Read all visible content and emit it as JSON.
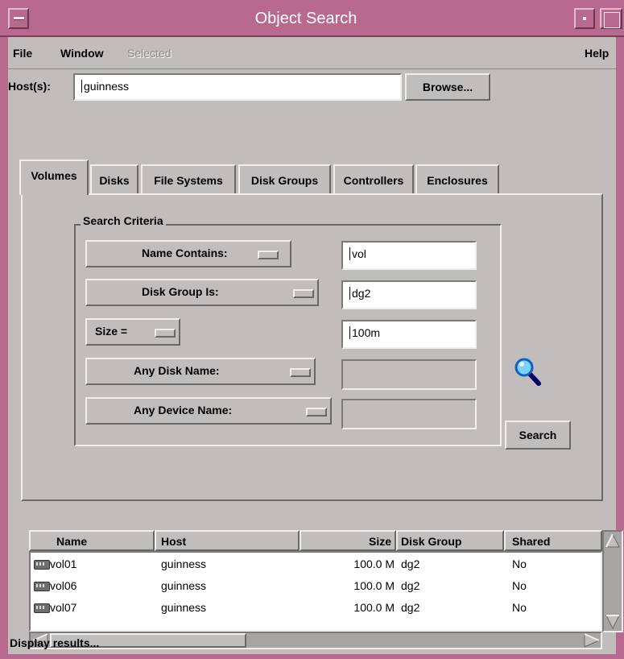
{
  "window": {
    "title": "Object Search"
  },
  "menu": {
    "file": "File",
    "window": "Window",
    "selected": "Selected",
    "help": "Help"
  },
  "host": {
    "label": "Host(s):",
    "value": "guinness",
    "browse_label": "Browse..."
  },
  "tabs": [
    "Volumes",
    "Disks",
    "File Systems",
    "Disk Groups",
    "Controllers",
    "Enclosures"
  ],
  "criteria": {
    "title": "Search Criteria",
    "rows": [
      {
        "option": "Name Contains:",
        "value": "vol"
      },
      {
        "option": "Disk Group Is:",
        "value": "dg2"
      },
      {
        "option": "Size =",
        "value": "100m"
      },
      {
        "option": "Any Disk Name:",
        "value": ""
      },
      {
        "option": "Any Device Name:",
        "value": ""
      }
    ],
    "search_label": "Search",
    "search_icon": "magnifier-icon"
  },
  "results": {
    "columns": [
      "Name",
      "Host",
      "Size",
      "Disk Group",
      "Shared"
    ],
    "rows": [
      [
        "vol01",
        "guinness",
        "100.0 M",
        "dg2",
        "No"
      ],
      [
        "vol06",
        "guinness",
        "100.0 M",
        "dg2",
        "No"
      ],
      [
        "vol07",
        "guinness",
        "100.0 M",
        "dg2",
        "No"
      ]
    ]
  },
  "status": "Display results...",
  "colors": {
    "titlebar": "#b8698e",
    "background": "#c0bdbc",
    "magnifier": "#1ea0e6"
  }
}
